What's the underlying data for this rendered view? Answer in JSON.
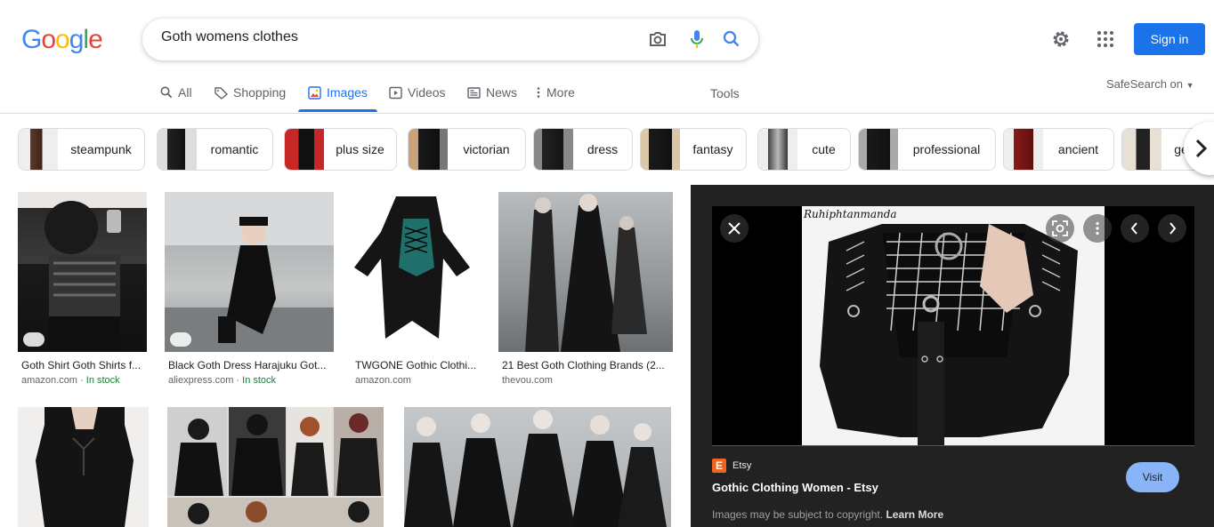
{
  "header": {
    "logo": [
      "G",
      "o",
      "o",
      "g",
      "l",
      "e"
    ],
    "logo_colors": [
      "#4285f4",
      "#ea4335",
      "#fbbc05",
      "#4285f4",
      "#34a853",
      "#ea4335"
    ],
    "search_value": "Goth womens clothes",
    "camera_icon": "camera-icon",
    "mic_icon": "microphone-icon",
    "search_icon": "search-icon",
    "settings_icon": "gear-icon",
    "apps_icon": "apps-grid-icon",
    "signin_label": "Sign in"
  },
  "tabs": [
    {
      "label": "All",
      "icon": "search-icon"
    },
    {
      "label": "Shopping",
      "icon": "tag-icon"
    },
    {
      "label": "Images",
      "icon": "image-icon",
      "active": true
    },
    {
      "label": "Videos",
      "icon": "play-icon"
    },
    {
      "label": "News",
      "icon": "newspaper-icon"
    },
    {
      "label": "More",
      "icon": "kebab-icon"
    }
  ],
  "tools_label": "Tools",
  "safesearch_label": "SafeSearch on",
  "chips": [
    "steampunk",
    "romantic",
    "plus size",
    "victorian",
    "dress",
    "fantasy",
    "cute",
    "professional",
    "ancient",
    "ge"
  ],
  "results": [
    {
      "caption": "Goth Shirt Goth Shirts f...",
      "source": "amazon.com",
      "stock": "In stock"
    },
    {
      "caption": "Black Goth Dress Harajuku Got...",
      "source": "aliexpress.com",
      "stock": "In stock"
    },
    {
      "caption": "TWGONE Gothic Clothi...",
      "source": "amazon.com",
      "stock": ""
    },
    {
      "caption": "21 Best Goth Clothing Brands (2...",
      "source": "thevou.com",
      "stock": ""
    }
  ],
  "stock_separator": " · ",
  "preview": {
    "watermark": "Ruhiphtanmanda",
    "source_name": "Etsy",
    "source_badge": "E",
    "title": "Gothic Clothing Women - Etsy",
    "visit_label": "Visit",
    "copyright_text": "Images may be subject to copyright.",
    "learn_more": "Learn More"
  },
  "colors": {
    "accent": "#1a73e8",
    "etsy": "#f1641e",
    "in_stock": "#188038"
  }
}
